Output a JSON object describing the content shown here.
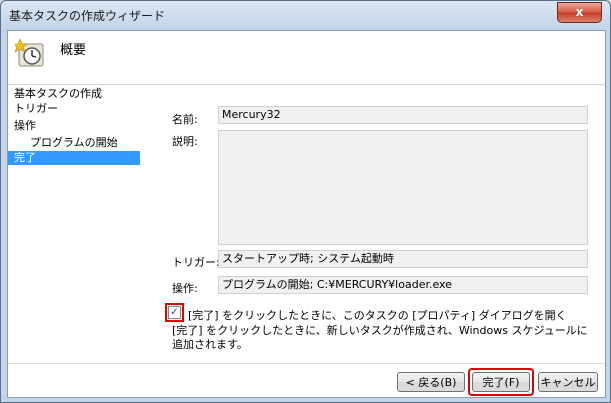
{
  "window": {
    "title": "基本タスクの作成ウィザード",
    "close_label": "x"
  },
  "header": {
    "title": "概要"
  },
  "nav": {
    "items": [
      "基本タスクの作成",
      "トリガー",
      "操作",
      "プログラムの開始",
      "完了"
    ]
  },
  "fields": {
    "name_label": "名前:",
    "name_value": "Mercury32",
    "description_label": "説明:",
    "description_value": "",
    "trigger_label": "トリガー:",
    "trigger_value": "スタートアップ時; システム起動時",
    "action_label": "操作:",
    "action_value": "プログラムの開始; C:¥MERCURY¥loader.exe"
  },
  "checkbox": {
    "label": "[完了] をクリックしたときに、このタスクの [プロパティ] ダイアログを開く",
    "checked": true
  },
  "info_text": "[完了] をクリックしたときに、新しいタスクが作成され、Windows スケジュールに追加されます。",
  "buttons": {
    "back": "< 戻る(B)",
    "finish": "完了(F)",
    "cancel": "キャンセル"
  },
  "colors": {
    "highlight_outline": "#e00000",
    "selection": "#3399ff"
  }
}
